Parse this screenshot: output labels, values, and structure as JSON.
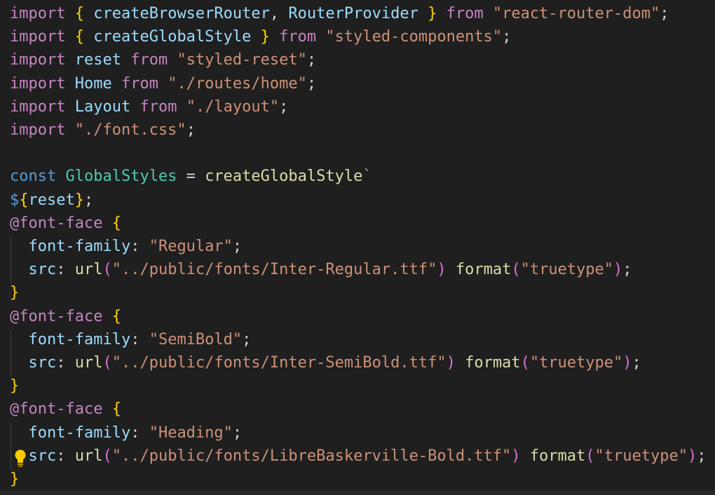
{
  "editor": {
    "language": "javascript",
    "lines": [
      [
        [
          "kw",
          "import"
        ],
        [
          "plain",
          " "
        ],
        [
          "br1",
          "{"
        ],
        [
          "plain",
          " "
        ],
        [
          "var",
          "createBrowserRouter"
        ],
        [
          "plain",
          ", "
        ],
        [
          "var",
          "RouterProvider"
        ],
        [
          "plain",
          " "
        ],
        [
          "br1",
          "}"
        ],
        [
          "plain",
          " "
        ],
        [
          "kw",
          "from"
        ],
        [
          "plain",
          " "
        ],
        [
          "str",
          "\"react-router-dom\""
        ],
        [
          "plain",
          ";"
        ]
      ],
      [
        [
          "kw",
          "import"
        ],
        [
          "plain",
          " "
        ],
        [
          "br1",
          "{"
        ],
        [
          "plain",
          " "
        ],
        [
          "var",
          "createGlobalStyle"
        ],
        [
          "plain",
          " "
        ],
        [
          "br1",
          "}"
        ],
        [
          "plain",
          " "
        ],
        [
          "kw",
          "from"
        ],
        [
          "plain",
          " "
        ],
        [
          "str",
          "\"styled-components\""
        ],
        [
          "plain",
          ";"
        ]
      ],
      [
        [
          "kw",
          "import"
        ],
        [
          "plain",
          " "
        ],
        [
          "var",
          "reset"
        ],
        [
          "plain",
          " "
        ],
        [
          "kw",
          "from"
        ],
        [
          "plain",
          " "
        ],
        [
          "str",
          "\"styled-reset\""
        ],
        [
          "plain",
          ";"
        ]
      ],
      [
        [
          "kw",
          "import"
        ],
        [
          "plain",
          " "
        ],
        [
          "var",
          "Home"
        ],
        [
          "plain",
          " "
        ],
        [
          "kw",
          "from"
        ],
        [
          "plain",
          " "
        ],
        [
          "str",
          "\"./routes/home\""
        ],
        [
          "plain",
          ";"
        ]
      ],
      [
        [
          "kw",
          "import"
        ],
        [
          "plain",
          " "
        ],
        [
          "var",
          "Layout"
        ],
        [
          "plain",
          " "
        ],
        [
          "kw",
          "from"
        ],
        [
          "plain",
          " "
        ],
        [
          "str",
          "\"./layout\""
        ],
        [
          "plain",
          ";"
        ]
      ],
      [
        [
          "kw",
          "import"
        ],
        [
          "plain",
          " "
        ],
        [
          "str",
          "\"./font.css\""
        ],
        [
          "plain",
          ";"
        ]
      ],
      [],
      [
        [
          "dk",
          "const"
        ],
        [
          "plain",
          " "
        ],
        [
          "cls",
          "GlobalStyles"
        ],
        [
          "plain",
          " = "
        ],
        [
          "fn",
          "createGlobalStyle"
        ],
        [
          "str",
          "`"
        ]
      ],
      [
        [
          "dk",
          "$"
        ],
        [
          "br1",
          "{"
        ],
        [
          "var",
          "reset"
        ],
        [
          "br1",
          "}"
        ],
        [
          "plain",
          ";"
        ]
      ],
      [
        [
          "kw",
          "@font-face"
        ],
        [
          "plain",
          " "
        ],
        [
          "br1",
          "{"
        ]
      ],
      [
        [
          "plain",
          "  "
        ],
        [
          "var",
          "font-family"
        ],
        [
          "plain",
          ": "
        ],
        [
          "str",
          "\"Regular\""
        ],
        [
          "plain",
          ";"
        ]
      ],
      [
        [
          "plain",
          "  "
        ],
        [
          "var",
          "src"
        ],
        [
          "plain",
          ": "
        ],
        [
          "fn",
          "url"
        ],
        [
          "br2",
          "("
        ],
        [
          "str",
          "\"../public/fonts/Inter-Regular.ttf\""
        ],
        [
          "br2",
          ")"
        ],
        [
          "plain",
          " "
        ],
        [
          "fn",
          "format"
        ],
        [
          "br2",
          "("
        ],
        [
          "str",
          "\"truetype\""
        ],
        [
          "br2",
          ")"
        ],
        [
          "plain",
          ";"
        ]
      ],
      [
        [
          "br1",
          "}"
        ]
      ],
      [
        [
          "kw",
          "@font-face"
        ],
        [
          "plain",
          " "
        ],
        [
          "br1",
          "{"
        ]
      ],
      [
        [
          "plain",
          "  "
        ],
        [
          "var",
          "font-family"
        ],
        [
          "plain",
          ": "
        ],
        [
          "str",
          "\"SemiBold\""
        ],
        [
          "plain",
          ";"
        ]
      ],
      [
        [
          "plain",
          "  "
        ],
        [
          "var",
          "src"
        ],
        [
          "plain",
          ": "
        ],
        [
          "fn",
          "url"
        ],
        [
          "br2",
          "("
        ],
        [
          "str",
          "\"../public/fonts/Inter-SemiBold.ttf\""
        ],
        [
          "br2",
          ")"
        ],
        [
          "plain",
          " "
        ],
        [
          "fn",
          "format"
        ],
        [
          "br2",
          "("
        ],
        [
          "str",
          "\"truetype\""
        ],
        [
          "br2",
          ")"
        ],
        [
          "plain",
          ";"
        ]
      ],
      [
        [
          "br1",
          "}"
        ]
      ],
      [
        [
          "kw",
          "@font-face"
        ],
        [
          "plain",
          " "
        ],
        [
          "br1",
          "{"
        ]
      ],
      [
        [
          "plain",
          "  "
        ],
        [
          "var",
          "font-family"
        ],
        [
          "plain",
          ": "
        ],
        [
          "str",
          "\"Heading\""
        ],
        [
          "plain",
          ";"
        ]
      ],
      [
        [
          "plain",
          "  "
        ],
        [
          "var",
          "src"
        ],
        [
          "plain",
          ": "
        ],
        [
          "fn",
          "url"
        ],
        [
          "br2",
          "("
        ],
        [
          "str",
          "\"../public/fonts/LibreBaskerville-Bold.ttf\""
        ],
        [
          "br2",
          ")"
        ],
        [
          "plain",
          " "
        ],
        [
          "fn",
          "format"
        ],
        [
          "br2",
          "("
        ],
        [
          "str",
          "\"truetype\""
        ],
        [
          "br2",
          ")"
        ],
        [
          "plain",
          ";"
        ]
      ],
      [
        [
          "br1",
          "}"
        ]
      ]
    ],
    "lightbulb_icon": "lightbulb-icon",
    "colors": {
      "background": "#1f1f1f",
      "keyword": "#c586c0",
      "declaration": "#569cd6",
      "string": "#ce9178",
      "variable": "#9cdcfe",
      "function": "#dcdcaa",
      "bracket": "#ffd700",
      "paren": "#da70d6"
    }
  }
}
